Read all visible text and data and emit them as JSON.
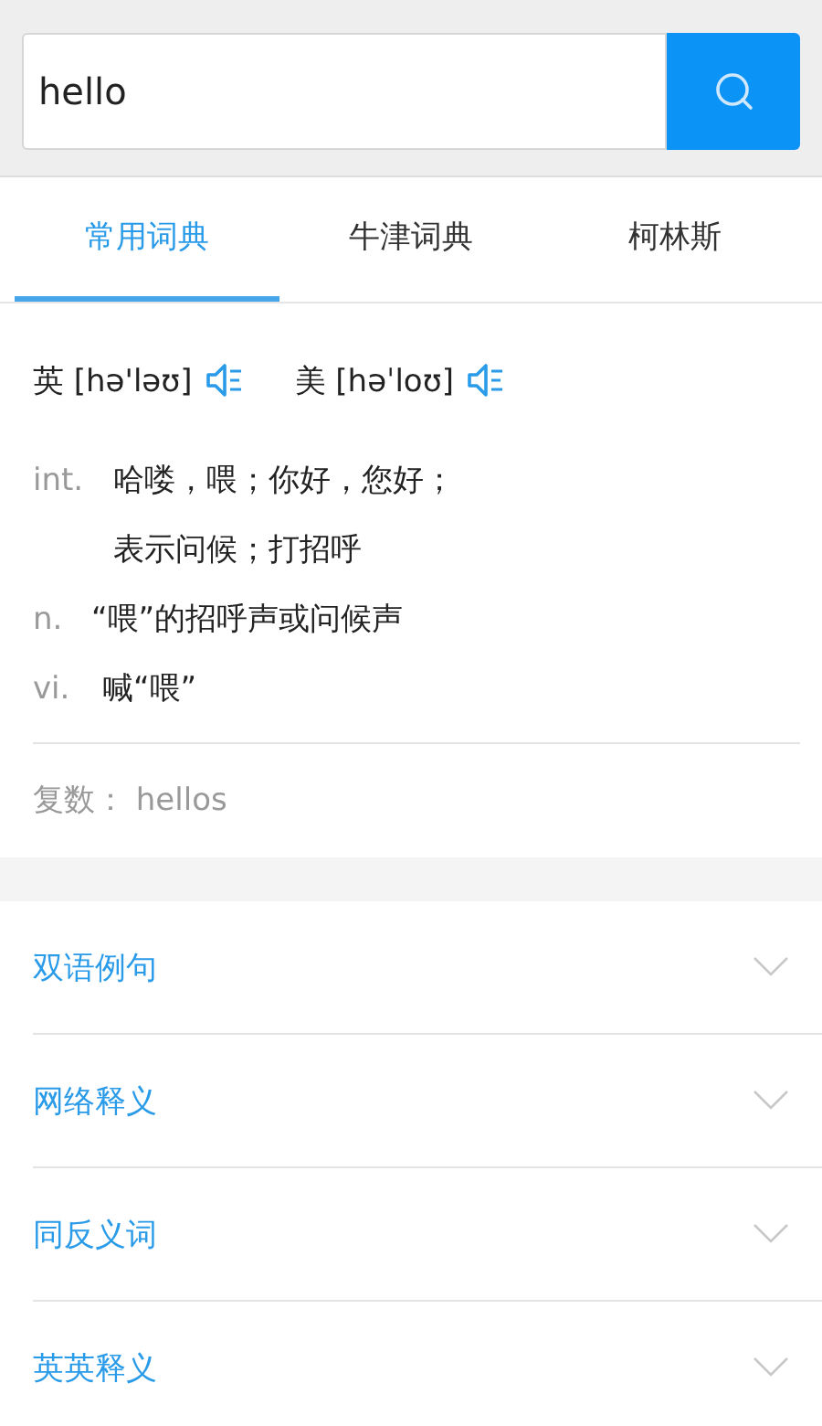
{
  "search": {
    "value": "hello"
  },
  "tabs": [
    {
      "label": "常用词典",
      "selected": true
    },
    {
      "label": "牛津词典",
      "selected": false
    },
    {
      "label": "柯林斯",
      "selected": false
    }
  ],
  "pronunciations": [
    {
      "region": "英",
      "phonetic": "[hə'ləʊ]"
    },
    {
      "region": "美",
      "phonetic": "[həˈloʊ]"
    }
  ],
  "definitions": [
    {
      "pos": "int.",
      "lines": [
        "哈喽，喂；你好，您好；",
        "表示问候；打招呼"
      ]
    },
    {
      "pos": "n.",
      "lines": [
        "“喂”的招呼声或问候声"
      ]
    },
    {
      "pos": "vi.",
      "lines": [
        "喊“喂”"
      ]
    }
  ],
  "plural": "复数：  hellos",
  "sections": [
    {
      "label": "双语例句",
      "expanded": false
    },
    {
      "label": "网络释义",
      "expanded": false
    },
    {
      "label": "同反义词",
      "expanded": false
    },
    {
      "label": "英英释义",
      "expanded": false
    }
  ]
}
